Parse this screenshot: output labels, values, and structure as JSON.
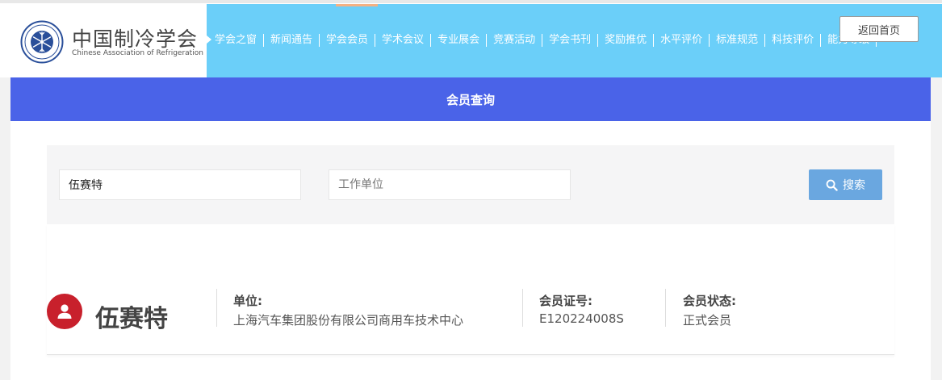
{
  "logo": {
    "name_cn": "中国制冷学会",
    "name_en": "Chinese Association of Refrigeration"
  },
  "nav": {
    "items": [
      "学会之窗",
      "新闻通告",
      "学会会员",
      "学术会议",
      "专业展会",
      "竞赛活动",
      "学会书刊",
      "奖励推优",
      "水平评价",
      "标准规范",
      "科技评价",
      "能力等级"
    ],
    "home_button": "返回首页"
  },
  "page": {
    "title": "会员查询"
  },
  "search": {
    "name_value": "伍赛特",
    "unit_placeholder": "工作单位",
    "button_label": "搜索"
  },
  "result": {
    "name": "伍赛特",
    "unit_label": "单位:",
    "unit_value": "上海汽车集团股份有限公司商用车技术中心",
    "cert_label": "会员证号:",
    "cert_value": "E120224008S",
    "status_label": "会员状态:",
    "status_value": "正式会员"
  },
  "colors": {
    "nav_bg": "#6bcff9",
    "title_bar": "#4a63e8",
    "search_button": "#6aa7e0",
    "avatar": "#c8202c"
  },
  "icons": {
    "logo": "snowflake-emblem-icon",
    "nav_arrow": "caret-right-icon",
    "search": "search-icon",
    "avatar": "user-icon"
  }
}
